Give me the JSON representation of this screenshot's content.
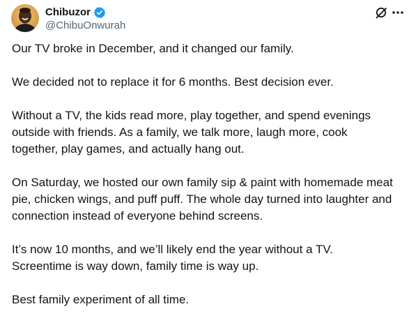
{
  "author": {
    "display_name": "Chibuzor",
    "handle": "@ChibuOnwurah",
    "verified": true
  },
  "colors": {
    "verified_badge": "#1d9bf0",
    "text_primary": "#0f1419",
    "text_secondary": "#536471"
  },
  "icons": {
    "verified": "verified-badge-icon",
    "grok": "grok-icon",
    "more": "more-options-icon"
  },
  "post": {
    "paragraphs": [
      [
        "Our TV broke in December, and it changed our family."
      ],
      [
        "We decided not to replace it for 6 months. Best decision ever."
      ],
      [
        "Without a TV, the kids read more, play together, and spend evenings",
        "outside with friends. As a family, we talk more, laugh more, cook",
        "together, play games, and actually hang out."
      ],
      [
        "On Saturday, we hosted our own family sip & paint with homemade meat",
        "pie, chicken wings, and puff puff. The whole day turned into laughter and",
        "connection instead of everyone behind screens."
      ],
      [
        "It’s now 10 months, and we’ll likely end the year without a TV.",
        "Screentime is way down, family time is way up."
      ],
      [
        "Best family experiment of all time."
      ]
    ]
  }
}
